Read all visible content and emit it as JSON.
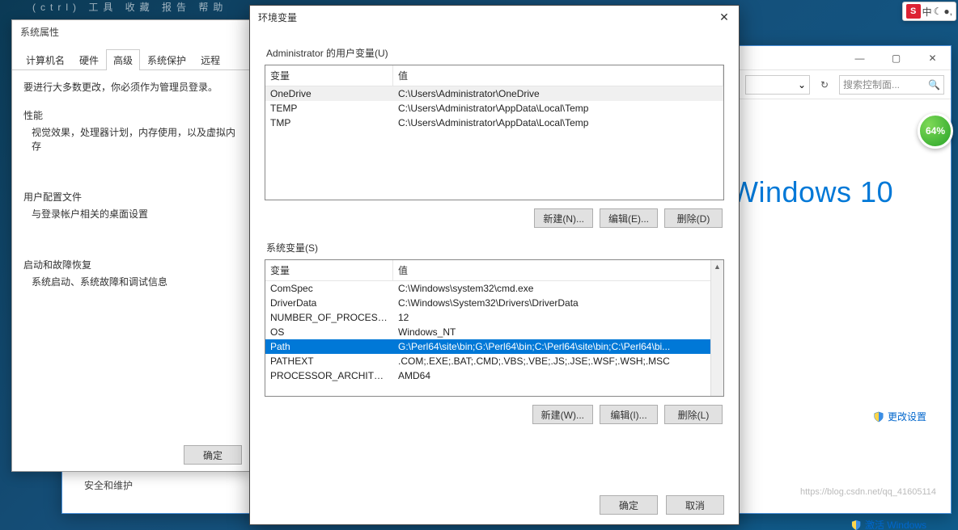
{
  "desktop": {
    "fragments": "(ctrl) 工具 收藏 报告 帮助"
  },
  "explorer": {
    "min": "—",
    "max": "▢",
    "close": "✕",
    "dropdown_caret": "⌄",
    "refresh": "↻",
    "search_placeholder": "搜索控制面...",
    "search_icon": "🔍",
    "logo": "Windows 10",
    "change_settings": "更改设置",
    "activate": "激活 Windows",
    "footer_note": "https://blog.csdn.net/qq_41605114"
  },
  "sysprops": {
    "title": "系统属性",
    "tabs": [
      "计算机名",
      "硬件",
      "高级",
      "系统保护",
      "远程"
    ],
    "active_tab_index": 2,
    "admin_hint": "要进行大多数更改，你必须作为管理员登录。",
    "perf_label": "性能",
    "perf_desc": "视觉效果，处理器计划，内存使用，以及虚拟内存",
    "profile_label": "用户配置文件",
    "profile_desc": "与登录帐户相关的桌面设置",
    "startup_label": "启动和故障恢复",
    "startup_desc": "系统启动、系统故障和调试信息",
    "ok": "确定",
    "safety_leftover": "安全和维护"
  },
  "envdlg": {
    "title": "环境变量",
    "close": "✕",
    "user_group": "Administrator 的用户变量(U)",
    "sys_group": "系统变量(S)",
    "col_var": "变量",
    "col_val": "值",
    "user_vars": [
      {
        "name": "OneDrive",
        "value": "C:\\Users\\Administrator\\OneDrive"
      },
      {
        "name": "TEMP",
        "value": "C:\\Users\\Administrator\\AppData\\Local\\Temp"
      },
      {
        "name": "TMP",
        "value": "C:\\Users\\Administrator\\AppData\\Local\\Temp"
      }
    ],
    "sys_vars": [
      {
        "name": "ComSpec",
        "value": "C:\\Windows\\system32\\cmd.exe"
      },
      {
        "name": "DriverData",
        "value": "C:\\Windows\\System32\\Drivers\\DriverData"
      },
      {
        "name": "NUMBER_OF_PROCESSORS",
        "value": "12"
      },
      {
        "name": "OS",
        "value": "Windows_NT"
      },
      {
        "name": "Path",
        "value": "G:\\Perl64\\site\\bin;G:\\Perl64\\bin;C:\\Perl64\\site\\bin;C:\\Perl64\\bi..."
      },
      {
        "name": "PATHEXT",
        "value": ".COM;.EXE;.BAT;.CMD;.VBS;.VBE;.JS;.JSE;.WSF;.WSH;.MSC"
      },
      {
        "name": "PROCESSOR_ARCHITECT...",
        "value": "AMD64"
      }
    ],
    "sys_selected_index": 4,
    "btn_new_u": "新建(N)...",
    "btn_edit_u": "编辑(E)...",
    "btn_del_u": "删除(D)",
    "btn_new_s": "新建(W)...",
    "btn_edit_s": "编辑(I)...",
    "btn_del_s": "删除(L)",
    "ok": "确定",
    "cancel": "取消"
  },
  "ime": {
    "s": "S",
    "lang": "中",
    "moon": "☾",
    "dot": "●,"
  },
  "battery": {
    "pct": "64%"
  }
}
